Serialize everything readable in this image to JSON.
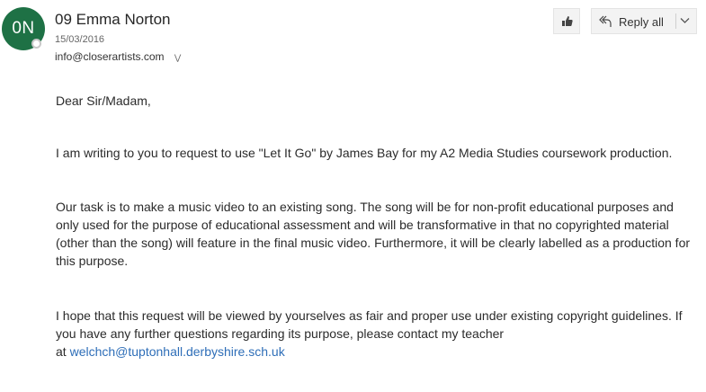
{
  "sender": {
    "initials": "0N",
    "name": "09 Emma Norton",
    "date": "15/03/2016",
    "recipient": "info@closerartists.com",
    "avatar_color": "#1e7145"
  },
  "actions": {
    "like_icon": "thumbs-up-icon",
    "reply_all_label": "Reply all",
    "reply_all_icon": "reply-all-icon",
    "dropdown_icon": "chevron-down-icon"
  },
  "message": {
    "greeting": "Dear Sir/Madam,",
    "paragraph1": "I am writing to you to request to use \"Let It Go\" by James Bay for my A2 Media Studies coursework production.",
    "paragraph2": "Our task is to make a music video to an existing song. The song will be for non-profit educational purposes and only used for the purpose of educational assessment and will be transformative in that no copyrighted material (other than the song) will feature in the final music video. Furthermore, it will be clearly labelled as a production for this purpose.",
    "paragraph3": "I hope that this request will be viewed by yourselves as fair and proper use under existing copyright guidelines. If you have any further questions regarding its purpose, please contact my teacher",
    "paragraph3_prefix": "at",
    "teacher_email": "welchch@tuptonhall.derbyshire.sch.uk",
    "link_color": "#2e6eb8"
  }
}
